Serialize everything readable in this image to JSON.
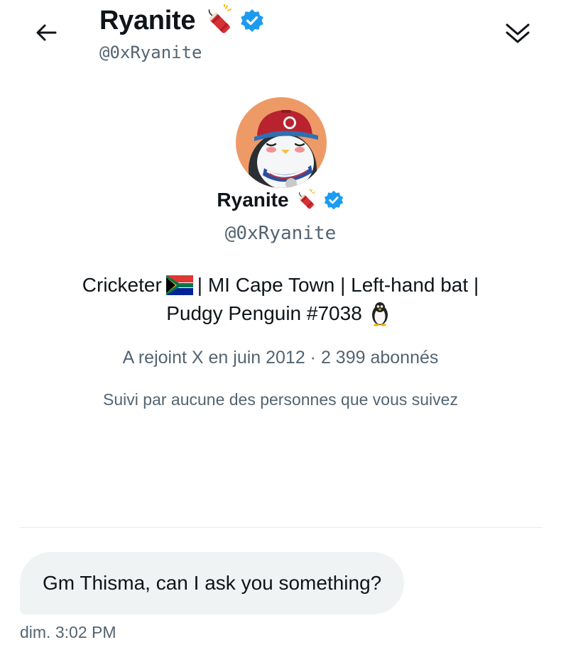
{
  "header": {
    "name": "Ryanite",
    "handle": "@0xRyanite",
    "back_icon": "arrow-left-icon",
    "collapse_icon": "double-chevron-down-icon"
  },
  "profile": {
    "name": "Ryanite",
    "handle": "@0xRyanite",
    "name_emoji": "firecracker-emoji",
    "verified_badge": "verified-badge-icon",
    "bio_line1_before_flag": "Cricketer",
    "bio_line1_after_flag": "| MI Cape Town | Left-hand bat |",
    "bio_line2": "Pudgy Penguin #7038",
    "bio_flag": "south-africa-flag",
    "bio_end_emoji": "penguin-emoji",
    "meta": "A rejoint X en juin 2012 · 2 399 abonnés",
    "followed_by": "Suivi par aucune des personnes que vous suivez"
  },
  "messages": [
    {
      "text": "Gm Thisma, can I ask you something?",
      "timestamp": "dim. 3:02 PM"
    }
  ],
  "colors": {
    "text": "#0f1419",
    "secondary": "#536471",
    "verified": "#1d9bf0",
    "bubble": "#eff3f4",
    "avatar_bg": "#ee9a67"
  }
}
